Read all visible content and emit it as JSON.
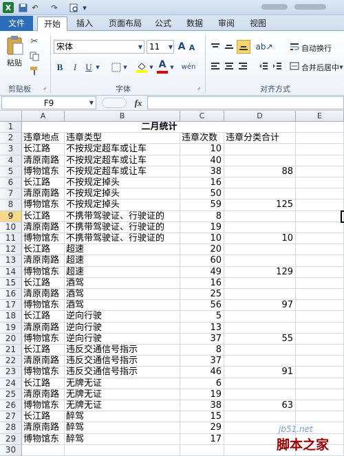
{
  "titlebar": {
    "undo_glyph": "↶",
    "redo_glyph": "↷",
    "dropdown_glyph": "▾"
  },
  "tabs": [
    "文件",
    "开始",
    "插入",
    "页面布局",
    "公式",
    "数据",
    "审阅",
    "视图"
  ],
  "ribbon": {
    "clipboard": {
      "paste_label": "粘贴",
      "group_label": "剪贴板"
    },
    "font": {
      "name": "宋体",
      "size": "11",
      "grow": "A",
      "shrink": "A",
      "bold": "B",
      "italic": "I",
      "underline": "U",
      "color_glyph": "A",
      "phonetic": "wén",
      "group_label": "字体"
    },
    "alignment": {
      "wrap_label": "自动换行",
      "merge_label": "合并后居中",
      "group_label": "对齐方式"
    }
  },
  "formula_bar": {
    "name_box": "F9",
    "fx": "fx",
    "content": ""
  },
  "columns": [
    "A",
    "B",
    "C",
    "D",
    "E"
  ],
  "rows": [
    {
      "n": "1",
      "title": "二月统计"
    },
    {
      "n": "2",
      "a": "违章地点",
      "b": "违章类型",
      "c": "违章次数",
      "d": "违章分类合计"
    },
    {
      "n": "3",
      "a": "长江路",
      "b": "不按规定超车或让车",
      "c": "10",
      "d": ""
    },
    {
      "n": "4",
      "a": "清原南路",
      "b": "不按规定超车或让车",
      "c": "40",
      "d": ""
    },
    {
      "n": "5",
      "a": "博物馆东",
      "b": "不按规定超车或让车",
      "c": "38",
      "d": "88"
    },
    {
      "n": "6",
      "a": "长江路",
      "b": "不按规定掉头",
      "c": "16",
      "d": ""
    },
    {
      "n": "7",
      "a": "清原南路",
      "b": "不按规定掉头",
      "c": "50",
      "d": ""
    },
    {
      "n": "8",
      "a": "博物馆东",
      "b": "不按规定掉头",
      "c": "59",
      "d": "125"
    },
    {
      "n": "9",
      "a": "长江路",
      "b": "不携带驾驶证、行驶证的",
      "c": "8",
      "d": ""
    },
    {
      "n": "10",
      "a": "清原南路",
      "b": "不携带驾驶证、行驶证的",
      "c": "19",
      "d": ""
    },
    {
      "n": "11",
      "a": "博物馆东",
      "b": "不携带驾驶证、行驶证的",
      "c": "10",
      "d": "10"
    },
    {
      "n": "12",
      "a": "长江路",
      "b": "超速",
      "c": "20",
      "d": ""
    },
    {
      "n": "13",
      "a": "清原南路",
      "b": "超速",
      "c": "60",
      "d": ""
    },
    {
      "n": "14",
      "a": "博物馆东",
      "b": "超速",
      "c": "49",
      "d": "129"
    },
    {
      "n": "15",
      "a": "长江路",
      "b": "酒驾",
      "c": "16",
      "d": ""
    },
    {
      "n": "16",
      "a": "清原南路",
      "b": "酒驾",
      "c": "25",
      "d": ""
    },
    {
      "n": "17",
      "a": "博物馆东",
      "b": "酒驾",
      "c": "56",
      "d": "97"
    },
    {
      "n": "18",
      "a": "长江路",
      "b": "逆向行驶",
      "c": "5",
      "d": ""
    },
    {
      "n": "19",
      "a": "清原南路",
      "b": "逆向行驶",
      "c": "13",
      "d": ""
    },
    {
      "n": "20",
      "a": "博物馆东",
      "b": "逆向行驶",
      "c": "37",
      "d": "55"
    },
    {
      "n": "21",
      "a": "长江路",
      "b": "违反交通信号指示",
      "c": "8",
      "d": ""
    },
    {
      "n": "22",
      "a": "清原南路",
      "b": "违反交通信号指示",
      "c": "37",
      "d": ""
    },
    {
      "n": "23",
      "a": "博物馆东",
      "b": "违反交通信号指示",
      "c": "46",
      "d": "91"
    },
    {
      "n": "24",
      "a": "长江路",
      "b": "无牌无证",
      "c": "6",
      "d": ""
    },
    {
      "n": "25",
      "a": "清原南路",
      "b": "无牌无证",
      "c": "19",
      "d": ""
    },
    {
      "n": "26",
      "a": "博物馆东",
      "b": "无牌无证",
      "c": "38",
      "d": "63"
    },
    {
      "n": "27",
      "a": "长江路",
      "b": "醉驾",
      "c": "15",
      "d": ""
    },
    {
      "n": "28",
      "a": "清原南路",
      "b": "醉驾",
      "c": "29",
      "d": ""
    },
    {
      "n": "29",
      "a": "博物馆东",
      "b": "醉驾",
      "c": "17",
      "d": ""
    },
    {
      "n": "30",
      "a": "",
      "b": "",
      "c": "",
      "d": ""
    }
  ],
  "watermark": {
    "line1": "jb51.net",
    "line2": "脚本之家"
  }
}
